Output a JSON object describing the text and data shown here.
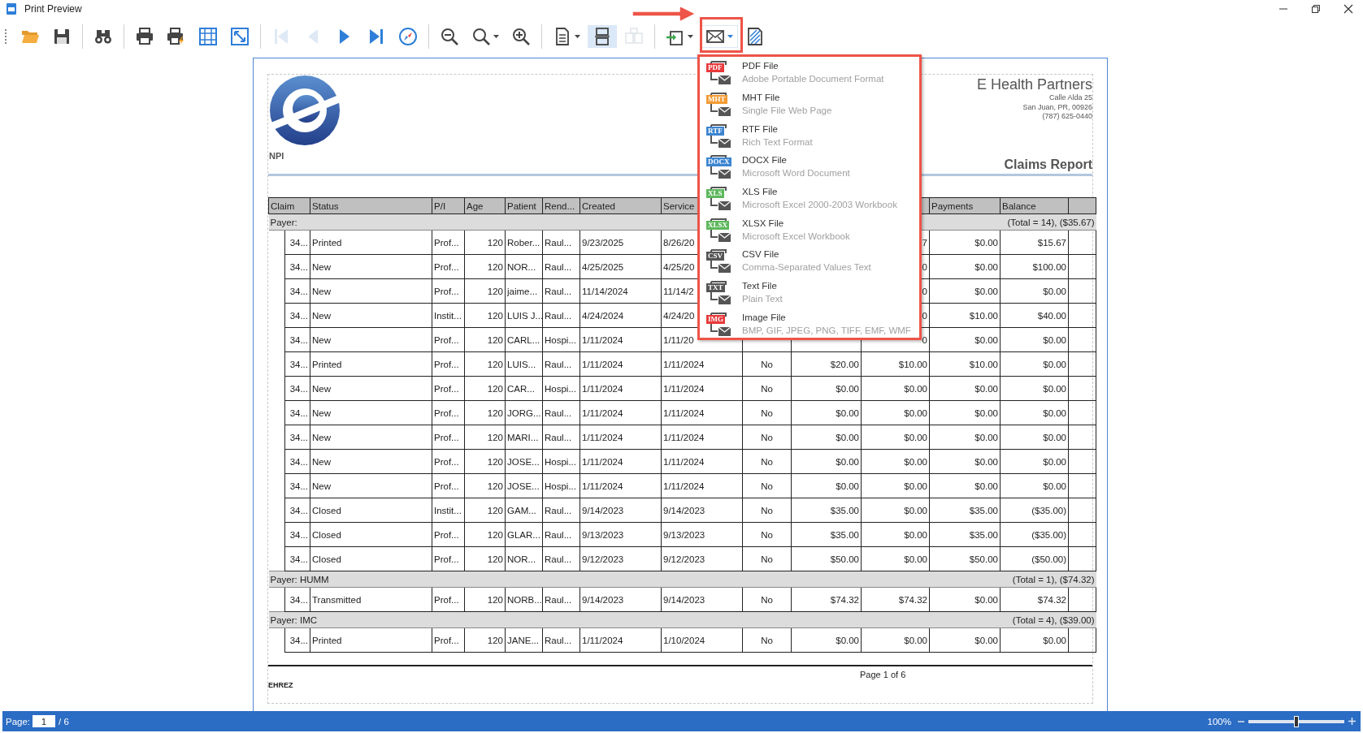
{
  "window": {
    "title": "Print Preview"
  },
  "toolbar": {
    "buttons": [
      {
        "kind": "open",
        "disabled": false,
        "selected": false,
        "dropdown": false
      },
      {
        "kind": "save",
        "disabled": false,
        "selected": false,
        "dropdown": false
      },
      {
        "kind": "separator"
      },
      {
        "kind": "find",
        "disabled": false,
        "selected": false,
        "dropdown": false
      },
      {
        "kind": "separator"
      },
      {
        "kind": "print",
        "disabled": false,
        "selected": false,
        "dropdown": false
      },
      {
        "kind": "quick-print",
        "disabled": false,
        "selected": false,
        "dropdown": false
      },
      {
        "kind": "page-setup",
        "disabled": false,
        "selected": false,
        "dropdown": false
      },
      {
        "kind": "scale",
        "disabled": false,
        "selected": false,
        "dropdown": false
      },
      {
        "kind": "separator"
      },
      {
        "kind": "first",
        "disabled": true,
        "selected": false,
        "dropdown": false
      },
      {
        "kind": "prev",
        "disabled": true,
        "selected": false,
        "dropdown": false
      },
      {
        "kind": "next",
        "disabled": false,
        "selected": false,
        "dropdown": false
      },
      {
        "kind": "last",
        "disabled": false,
        "selected": false,
        "dropdown": false
      },
      {
        "kind": "navigate",
        "disabled": false,
        "selected": false,
        "dropdown": false
      },
      {
        "kind": "separator"
      },
      {
        "kind": "zoom-out",
        "disabled": false,
        "selected": false,
        "dropdown": false
      },
      {
        "kind": "zoom",
        "disabled": false,
        "selected": false,
        "dropdown": true
      },
      {
        "kind": "zoom-in",
        "disabled": false,
        "selected": false,
        "dropdown": false
      },
      {
        "kind": "separator"
      },
      {
        "kind": "page-layout",
        "disabled": false,
        "selected": false,
        "dropdown": true
      },
      {
        "kind": "multi-page",
        "disabled": false,
        "selected": true,
        "dropdown": false
      },
      {
        "kind": "copy",
        "disabled": true,
        "selected": false,
        "dropdown": false
      },
      {
        "kind": "separator"
      },
      {
        "kind": "export",
        "disabled": false,
        "selected": false,
        "dropdown": true
      },
      {
        "kind": "email",
        "disabled": false,
        "selected": true,
        "dropdown": true
      },
      {
        "kind": "watermark",
        "disabled": false,
        "selected": false,
        "dropdown": false
      }
    ]
  },
  "report": {
    "npi_label": "NPI",
    "company": "E Health Partners",
    "address": [
      "Calle Alda 25",
      "San Juan, PR, 00926",
      "(787) 625-0440"
    ],
    "title": "Claims Report",
    "table": {
      "columns": [
        "Claim",
        "Status",
        "P/I",
        "Age",
        "Patient",
        "Rend...",
        "Created",
        "Service",
        null,
        null,
        null,
        "Payments",
        "Balance"
      ],
      "groups": [
        {
          "label": "Payer:",
          "total": "(Total = 14), ($35.67)",
          "rows": [
            [
              "34...",
              "Printed",
              "Prof...",
              "120",
              "Rober...",
              "Raul...",
              "9/23/2025",
              "8/26/20",
              null,
              null,
              "7",
              "$0.00",
              "$15.67"
            ],
            [
              "34...",
              "New",
              "Prof...",
              "120",
              "NOR...",
              "Raul...",
              "4/25/2025",
              "4/25/20",
              null,
              null,
              "0",
              "$0.00",
              "$100.00"
            ],
            [
              "34...",
              "New",
              "Prof...",
              "120",
              "jaime...",
              "Raul...",
              "11/14/2024",
              "11/14/2",
              null,
              null,
              "0",
              "$0.00",
              "$0.00"
            ],
            [
              "34...",
              "New",
              "Instit...",
              "120",
              "LUIS J...",
              "Raul...",
              "4/24/2024",
              "4/24/20",
              null,
              null,
              "0",
              "$10.00",
              "$40.00"
            ],
            [
              "34...",
              "New",
              "Prof...",
              "120",
              "CARL...",
              "Hospi...",
              "1/11/2024",
              "1/11/20",
              null,
              null,
              "0",
              "$0.00",
              "$0.00"
            ],
            [
              "34...",
              "Printed",
              "Prof...",
              "120",
              "LUIS...",
              "Raul...",
              "1/11/2024",
              "1/11/2024",
              "No",
              "$20.00",
              "$10.00",
              "$10.00",
              "$0.00"
            ],
            [
              "34...",
              "New",
              "Prof...",
              "120",
              "CAR...",
              "Hospi...",
              "1/11/2024",
              "1/11/2024",
              "No",
              "$0.00",
              "$0.00",
              "$0.00",
              "$0.00"
            ],
            [
              "34...",
              "New",
              "Prof...",
              "120",
              "JORG...",
              "Raul...",
              "1/11/2024",
              "1/11/2024",
              "No",
              "$0.00",
              "$0.00",
              "$0.00",
              "$0.00"
            ],
            [
              "34...",
              "New",
              "Prof...",
              "120",
              "MARI...",
              "Raul...",
              "1/11/2024",
              "1/11/2024",
              "No",
              "$0.00",
              "$0.00",
              "$0.00",
              "$0.00"
            ],
            [
              "34...",
              "New",
              "Prof...",
              "120",
              "JOSE...",
              "Hospi...",
              "1/11/2024",
              "1/11/2024",
              "No",
              "$0.00",
              "$0.00",
              "$0.00",
              "$0.00"
            ],
            [
              "34...",
              "New",
              "Prof...",
              "120",
              "JOSE...",
              "Hospi...",
              "1/11/2024",
              "1/11/2024",
              "No",
              "$0.00",
              "$0.00",
              "$0.00",
              "$0.00"
            ],
            [
              "34...",
              "Closed",
              "Instit...",
              "120",
              "GAM...",
              "Raul...",
              "9/14/2023",
              "9/14/2023",
              "No",
              "$35.00",
              "$0.00",
              "$35.00",
              "($35.00)"
            ],
            [
              "34...",
              "Closed",
              "Prof...",
              "120",
              "GLAR...",
              "Raul...",
              "9/13/2023",
              "9/13/2023",
              "No",
              "$35.00",
              "$0.00",
              "$35.00",
              "($35.00)"
            ],
            [
              "34...",
              "Closed",
              "Prof...",
              "120",
              "NOR...",
              "Raul...",
              "9/12/2023",
              "9/12/2023",
              "No",
              "$50.00",
              "$0.00",
              "$50.00",
              "($50.00)"
            ]
          ]
        },
        {
          "label": "Payer: HUMM",
          "total": "(Total = 1), ($74.32)",
          "rows": [
            [
              "34...",
              "Transmitted",
              "Prof...",
              "120",
              "NORB...",
              "Raul...",
              "9/14/2023",
              "9/14/2023",
              "No",
              "$74.32",
              "$74.32",
              "$0.00",
              "$74.32"
            ]
          ]
        },
        {
          "label": "Payer: IMC",
          "total": "(Total = 4), ($39.00)",
          "rows": [
            [
              "34...",
              "Printed",
              "Prof...",
              "120",
              "JANE...",
              "Raul...",
              "1/11/2024",
              "1/10/2024",
              "No",
              "$0.00",
              "$0.00",
              "$0.00",
              "$0.00"
            ]
          ]
        }
      ]
    },
    "footer": {
      "page": "Page 1 of 6",
      "user": "EHREZ"
    }
  },
  "menu": {
    "items": [
      {
        "badge": "PDF",
        "color": "#e8393b",
        "title": "PDF File",
        "description": "Adobe Portable Document Format"
      },
      {
        "badge": "MHT",
        "color": "#f39a32",
        "title": "MHT File",
        "description": "Single File Web Page"
      },
      {
        "badge": "RTF",
        "color": "#3d85d1",
        "title": "RTF File",
        "description": "Rich Text Format"
      },
      {
        "badge": "DOCX",
        "color": "#3d85d1",
        "title": "DOCX File",
        "description": "Microsoft Word Document"
      },
      {
        "badge": "XLS",
        "color": "#5cb85c",
        "title": "XLS File",
        "description": "Microsoft Excel 2000-2003 Workbook"
      },
      {
        "badge": "XLSX",
        "color": "#5cb85c",
        "title": "XLSX File",
        "description": "Microsoft Excel Workbook"
      },
      {
        "badge": "CSV",
        "color": "#555555",
        "title": "CSV File",
        "description": "Comma-Separated Values Text"
      },
      {
        "badge": "TXT",
        "color": "#555555",
        "title": "Text File",
        "description": "Plain Text"
      },
      {
        "badge": "IMG",
        "color": "#e8393b",
        "title": "Image File",
        "description": "BMP, GIF, JPEG, PNG, TIFF, EMF, WMF"
      }
    ]
  },
  "status_bar": {
    "page_label": "Page:",
    "page_value": "1",
    "page_total": "/ 6",
    "zoom": {
      "reading": "100%",
      "level": 0.5
    }
  }
}
